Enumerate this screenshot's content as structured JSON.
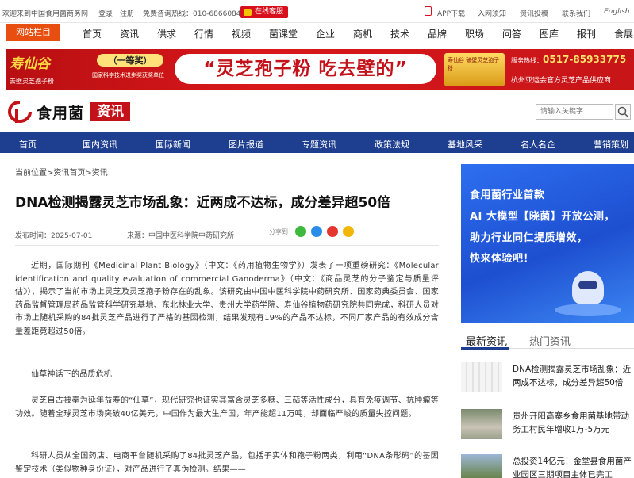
{
  "topbar": {
    "welcome": "欢迎来到中国食用菌商务网",
    "login": "登录",
    "register": "注册",
    "hotline": "免费咨询热线：010-68660844",
    "online_service": "在线客服",
    "app_download": "APP下载",
    "membership": "入网须知",
    "submit": "资讯投稿",
    "contact": "联系我们",
    "english": "English"
  },
  "mainnav": {
    "site_columns": "网站栏目",
    "items": [
      "首页",
      "资讯",
      "供求",
      "行情",
      "视频",
      "菌课堂",
      "企业",
      "商机",
      "技术",
      "品牌",
      "职场",
      "问答",
      "图库",
      "报刊",
      "食展"
    ]
  },
  "banner": {
    "brand": "寿仙谷",
    "brand_sub": "去壁灵芝孢子粉",
    "award": "（一等奖）",
    "award_sub": "国家科学技术进步奖获奖单位",
    "slogan": "“灵芝孢子粉 吃去壁的”",
    "product": "寿仙谷 破壁灵芝孢子粉",
    "tel_label": "服务热线：",
    "tel": "0517-85933775",
    "supplier": "杭州亚运会官方灵芝产品供应商"
  },
  "logo": {
    "text": "食用菌",
    "badge": "资讯"
  },
  "search": {
    "placeholder": "请输入关键字"
  },
  "bluenav": {
    "items": [
      "首页",
      "国内资讯",
      "国际新闻",
      "图片报道",
      "专题资讯",
      "政策法规",
      "基地风采",
      "名人名企",
      "营销策划"
    ]
  },
  "article": {
    "breadcrumb": "当前位置>资讯首页>资讯",
    "title": "DNA检测揭露灵芝市场乱象：近两成不达标，成分差异超50倍",
    "date": "发布时间：2025-07-01",
    "source": "来源：中国中医科学院中药研究所",
    "share_label": "分享到",
    "paragraphs": [
      "近期，国际期刊《Medicinal Plant Biology》（中文：《药用植物生物学》）发表了一项重磅研究：《Molecular identification and quality evaluation of commercial Ganoderma》（中文：《商品灵芝的分子鉴定与质量评估》），揭示了当前市场上灵芝及灵芝孢子粉存在的乱象。该研究由中国中医科学院中药研究所、国家药典委员会、国家药品监督管理局药品监管科学研究基地、东北林业大学、贵州大学药学院、寿仙谷植物药研究院共同完成，科研人员对市场上随机采购的84批灵芝产品进行了严格的基因检测，结果发现有19%的产品不达标，不同厂家产品的有效成分含量差距竟超过50倍。",
      "仙草神话下的品质危机",
      "灵芝自古被奉为延年益寿的“仙草”，现代研究也证实其富含灵芝多糖、三萜等活性成分，具有免疫调节、抗肿瘤等功效。随着全球灵芝市场突破40亿美元，中国作为最大生产国，年产能超11万吨，却面临严峻的质量失控问题。",
      "科研人员从全国药店、电商平台随机采购了84批灵芝产品，包括子实体和孢子粉两类，利用“DNA条形码”的基因鉴定技术（类似物种身份证），对产品进行了真伪检测。结果——"
    ]
  },
  "ad": {
    "lines": [
      "食用菌行业首款",
      "AI 大模型【晓菌】开放公测，",
      "助力行业同仁提质增效，",
      "快来体验吧！"
    ]
  },
  "sidebar": {
    "tab_latest": "最新资讯",
    "tab_hot": "热门资讯",
    "news": [
      "DNA检测揭露灵芝市场乱象：近两成不达标，成分差异超50倍",
      "贵州开阳高寨乡食用菌基地带动务工村民年增收1万-5万元",
      "总投资14亿元！金堂县食用菌产业园区三期项目主体已完工"
    ]
  },
  "colors": {
    "brand_red": "#c4121a",
    "nav_blue": "#1e3f8f",
    "orange": "#e84e0f"
  }
}
